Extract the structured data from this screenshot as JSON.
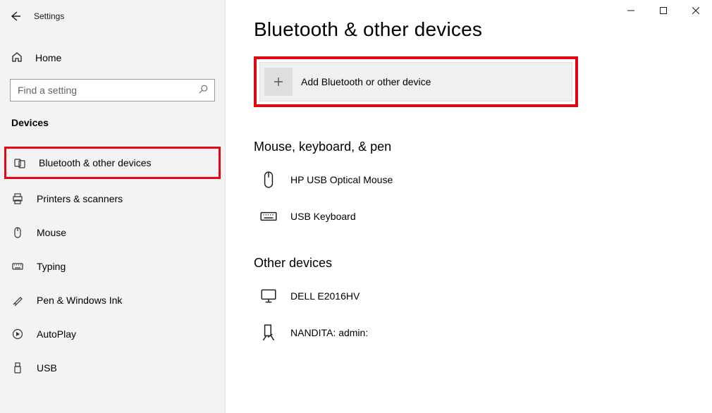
{
  "app_title": "Settings",
  "window_controls": {
    "minimize": "minimize",
    "maximize": "maximize",
    "close": "close"
  },
  "sidebar": {
    "home_label": "Home",
    "search_placeholder": "Find a setting",
    "section_label": "Devices",
    "items": [
      {
        "label": "Bluetooth & other devices",
        "icon": "bluetooth-devices-icon",
        "highlighted": true
      },
      {
        "label": "Printers & scanners",
        "icon": "printer-icon"
      },
      {
        "label": "Mouse",
        "icon": "mouse-icon"
      },
      {
        "label": "Typing",
        "icon": "keyboard-icon"
      },
      {
        "label": "Pen & Windows Ink",
        "icon": "pen-icon"
      },
      {
        "label": "AutoPlay",
        "icon": "autoplay-icon"
      },
      {
        "label": "USB",
        "icon": "usb-icon"
      }
    ]
  },
  "main": {
    "page_title": "Bluetooth & other devices",
    "add_button_label": "Add Bluetooth or other device",
    "sections": [
      {
        "title": "Mouse, keyboard, & pen",
        "devices": [
          {
            "label": "HP USB Optical Mouse",
            "icon": "mouse-icon"
          },
          {
            "label": "USB Keyboard",
            "icon": "keyboard-icon"
          }
        ]
      },
      {
        "title": "Other devices",
        "devices": [
          {
            "label": "DELL E2016HV",
            "icon": "monitor-icon"
          },
          {
            "label": "NANDITA: admin:",
            "icon": "device-misc-icon"
          }
        ]
      }
    ]
  },
  "annotations": {
    "sidebar_item_highlight": "red-box",
    "add_button_highlight": "red-box"
  }
}
